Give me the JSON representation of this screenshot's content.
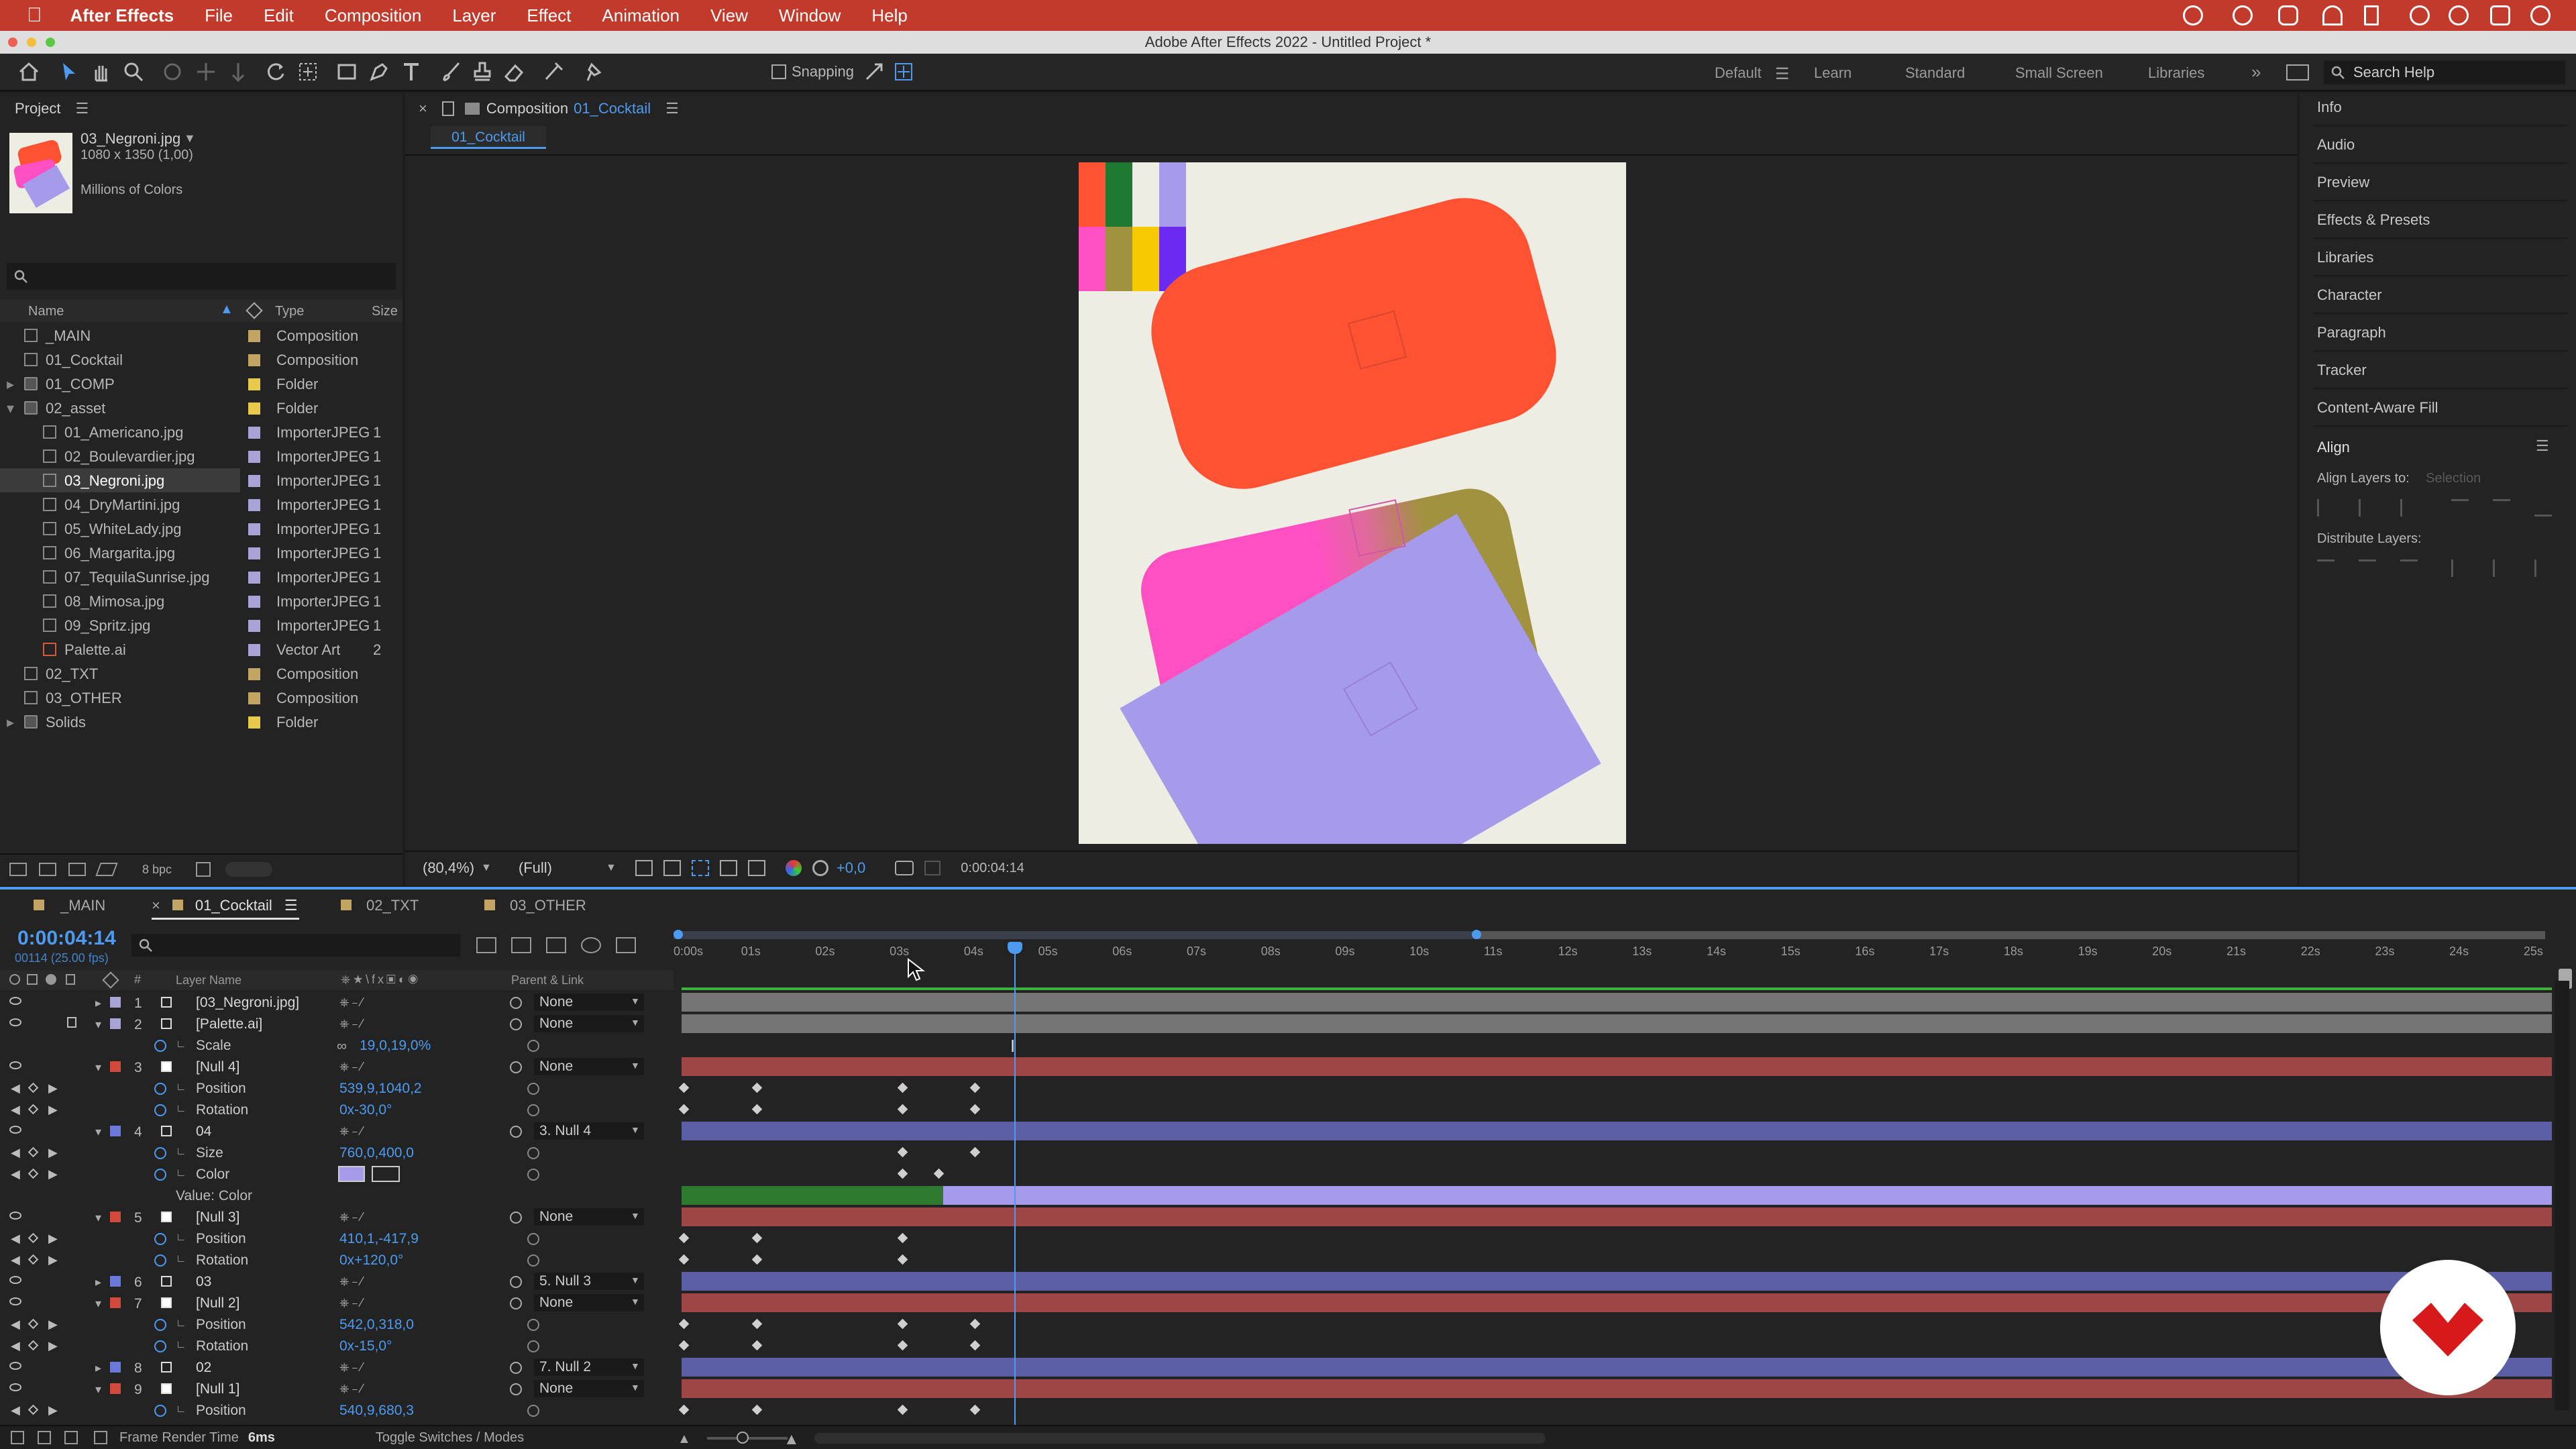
{
  "menubar": {
    "app": "After Effects",
    "items": [
      "File",
      "Edit",
      "Composition",
      "Layer",
      "Effect",
      "Animation",
      "View",
      "Window",
      "Help"
    ]
  },
  "window_title": "Adobe After Effects 2022 - Untitled Project *",
  "toolbar": {
    "snapping": "Snapping",
    "workspaces": [
      "Default",
      "Learn",
      "Standard",
      "Small Screen",
      "Libraries"
    ],
    "search_placeholder": "Search Help"
  },
  "project": {
    "title": "Project",
    "selected_name": "03_Negroni.jpg",
    "selected_dims": "1080 x 1350 (1,00)",
    "selected_colors": "Millions of Colors",
    "columns": {
      "name": "Name",
      "type": "Type",
      "size": "Size"
    },
    "items": [
      {
        "name": "_MAIN",
        "type": "Composition",
        "size": "",
        "indent": 0,
        "kind": "comp",
        "label": "#c2a463"
      },
      {
        "name": "01_Cocktail",
        "type": "Composition",
        "size": "",
        "indent": 0,
        "kind": "comp",
        "label": "#c2a463"
      },
      {
        "name": "01_COMP",
        "type": "Folder",
        "size": "",
        "indent": 0,
        "kind": "folder",
        "label": "#e8c94c"
      },
      {
        "name": "02_asset",
        "type": "Folder",
        "size": "",
        "indent": 0,
        "kind": "folder",
        "label": "#e8c94c"
      },
      {
        "name": "01_Americano.jpg",
        "type": "ImporterJPEG",
        "size": "1",
        "indent": 1,
        "kind": "file",
        "label": "#a8a3d6"
      },
      {
        "name": "02_Boulevardier.jpg",
        "type": "ImporterJPEG",
        "size": "1",
        "indent": 1,
        "kind": "file",
        "label": "#a8a3d6"
      },
      {
        "name": "03_Negroni.jpg",
        "type": "ImporterJPEG",
        "size": "1",
        "indent": 1,
        "kind": "file",
        "label": "#a8a3d6"
      },
      {
        "name": "04_DryMartini.jpg",
        "type": "ImporterJPEG",
        "size": "1",
        "indent": 1,
        "kind": "file",
        "label": "#a8a3d6"
      },
      {
        "name": "05_WhiteLady.jpg",
        "type": "ImporterJPEG",
        "size": "1",
        "indent": 1,
        "kind": "file",
        "label": "#a8a3d6"
      },
      {
        "name": "06_Margarita.jpg",
        "type": "ImporterJPEG",
        "size": "1",
        "indent": 1,
        "kind": "file",
        "label": "#a8a3d6"
      },
      {
        "name": "07_TequilaSunrise.jpg",
        "type": "ImporterJPEG",
        "size": "1",
        "indent": 1,
        "kind": "file",
        "label": "#a8a3d6"
      },
      {
        "name": "08_Mimosa.jpg",
        "type": "ImporterJPEG",
        "size": "1",
        "indent": 1,
        "kind": "file",
        "label": "#a8a3d6"
      },
      {
        "name": "09_Spritz.jpg",
        "type": "ImporterJPEG",
        "size": "1",
        "indent": 1,
        "kind": "file",
        "label": "#a8a3d6"
      },
      {
        "name": "Palette.ai",
        "type": "Vector Art",
        "size": "2",
        "indent": 1,
        "kind": "ai",
        "label": "#a8a3d6"
      },
      {
        "name": "02_TXT",
        "type": "Composition",
        "size": "",
        "indent": 0,
        "kind": "comp",
        "label": "#c2a463"
      },
      {
        "name": "03_OTHER",
        "type": "Composition",
        "size": "",
        "indent": 0,
        "kind": "comp",
        "label": "#c2a463"
      },
      {
        "name": "Solids",
        "type": "Folder",
        "size": "",
        "indent": 0,
        "kind": "folder",
        "label": "#e8c94c"
      }
    ],
    "bpc": "8 bpc"
  },
  "composition": {
    "panel_label": "Composition",
    "comp_name": "01_Cocktail",
    "tab": "01_Cocktail",
    "zoom": "(80,4%)",
    "resolution": "(Full)",
    "exposure": "+0,0",
    "timecode": "0:00:04:14"
  },
  "right_panels": [
    "Info",
    "Audio",
    "Preview",
    "Effects & Presets",
    "Libraries",
    "Character",
    "Paragraph",
    "Tracker",
    "Content-Aware Fill"
  ],
  "align": {
    "title": "Align",
    "align_to_label": "Align Layers to:",
    "align_to_value": "Selection",
    "distribute_label": "Distribute Layers:"
  },
  "timeline": {
    "tabs": [
      "_MAIN",
      "01_Cocktail",
      "02_TXT",
      "03_OTHER"
    ],
    "timecode": "0:00:04:14",
    "frames": "00114 (25.00 fps)",
    "ruler": [
      "0:00s",
      "01s",
      "02s",
      "03s",
      "04s",
      "05s",
      "06s",
      "07s",
      "08s",
      "09s",
      "10s",
      "11s",
      "12s",
      "13s",
      "14s",
      "15s",
      "16s",
      "17s",
      "18s",
      "19s",
      "20s",
      "21s",
      "22s",
      "23s",
      "24s",
      "25s"
    ],
    "col_layer_name": "Layer Name",
    "col_parent": "Parent & Link",
    "rows": [
      {
        "type": "layer",
        "num": "1",
        "name": "[03_Negroni.jpg]",
        "parent": "None",
        "label": "#a8a3d6",
        "bar": "#757575"
      },
      {
        "type": "layer",
        "num": "2",
        "name": "[Palette.ai]",
        "parent": "None",
        "label": "#a8a3d6",
        "bar": "#757575"
      },
      {
        "type": "prop",
        "name": "Scale",
        "value": "19,0,19,0%"
      },
      {
        "type": "layer",
        "num": "3",
        "name": "[Null 4]",
        "parent": "None",
        "label": "#d14a3c",
        "bar": "#9e4545"
      },
      {
        "type": "prop",
        "name": "Position",
        "value": "539,9,1040,2",
        "kf": [
          0,
          1,
          3,
          4
        ]
      },
      {
        "type": "prop",
        "name": "Rotation",
        "value": "0x-30,0°",
        "kf": [
          0,
          1,
          3,
          4
        ]
      },
      {
        "type": "layer",
        "num": "4",
        "name": "04",
        "parent": "3. Null 4",
        "label": "#6d79d8",
        "bar": "#5c5ea6"
      },
      {
        "type": "prop",
        "name": "Size",
        "value": "760,0,400,0",
        "kf": [
          3,
          4
        ]
      },
      {
        "type": "prop",
        "name": "Color",
        "value": "",
        "kf": [
          3,
          3.5
        ]
      },
      {
        "type": "value",
        "name": "Value: Color"
      },
      {
        "type": "layer",
        "num": "5",
        "name": "[Null 3]",
        "parent": "None",
        "label": "#d14a3c",
        "bar": "#9e4545"
      },
      {
        "type": "prop",
        "name": "Position",
        "value": "410,1,-417,9",
        "kf": [
          0,
          1,
          3
        ]
      },
      {
        "type": "prop",
        "name": "Rotation",
        "value": "0x+120,0°",
        "kf": [
          0,
          1,
          3
        ]
      },
      {
        "type": "layer",
        "num": "6",
        "name": "03",
        "parent": "5. Null 3",
        "label": "#6d79d8",
        "bar": "#5c5ea6"
      },
      {
        "type": "layer",
        "num": "7",
        "name": "[Null 2]",
        "parent": "None",
        "label": "#d14a3c",
        "bar": "#9e4545"
      },
      {
        "type": "prop",
        "name": "Position",
        "value": "542,0,318,0",
        "kf": [
          0,
          1,
          3,
          4
        ]
      },
      {
        "type": "prop",
        "name": "Rotation",
        "value": "0x-15,0°",
        "kf": [
          0,
          1,
          3,
          4
        ]
      },
      {
        "type": "layer",
        "num": "8",
        "name": "02",
        "parent": "7. Null 2",
        "label": "#6d79d8",
        "bar": "#5c5ea6"
      },
      {
        "type": "layer",
        "num": "9",
        "name": "[Null 1]",
        "parent": "None",
        "label": "#d14a3c",
        "bar": "#9e4545"
      },
      {
        "type": "prop",
        "name": "Position",
        "value": "540,9,680,3",
        "kf": [
          0,
          1,
          3,
          4
        ]
      }
    ],
    "footer_render_label": "Frame Render Time",
    "footer_render_value": "6ms",
    "footer_toggle": "Toggle Switches / Modes"
  },
  "colors": {
    "accent": "#4c9bf0",
    "menubar": "#c23a2b",
    "coral": "#ff5233",
    "pink": "#ff4fc3",
    "olive": "#a0923f",
    "lavender": "#a59bea",
    "canvas": "#eeede4",
    "logo": "#d7191c"
  }
}
